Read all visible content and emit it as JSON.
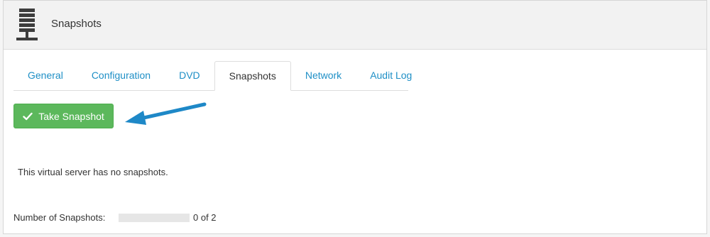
{
  "header": {
    "title": "Snapshots",
    "icon": "server-icon"
  },
  "tabs": [
    {
      "label": "General",
      "active": false
    },
    {
      "label": "Configuration",
      "active": false
    },
    {
      "label": "DVD",
      "active": false
    },
    {
      "label": "Snapshots",
      "active": true
    },
    {
      "label": "Network",
      "active": false
    },
    {
      "label": "Audit Log",
      "active": false
    }
  ],
  "actions": {
    "take_snapshot_label": "Take Snapshot",
    "take_snapshot_icon": "check-icon",
    "take_snapshot_color": "#5cb85c"
  },
  "annotation": {
    "arrow_color": "#1e88c7"
  },
  "content": {
    "empty_message": "This virtual server has no snapshots."
  },
  "summary": {
    "label": "Number of Snapshots:",
    "value": "0 of 2",
    "used": 0,
    "max": 2
  },
  "colors": {
    "link": "#1e8fc6",
    "success": "#5cb85c"
  }
}
